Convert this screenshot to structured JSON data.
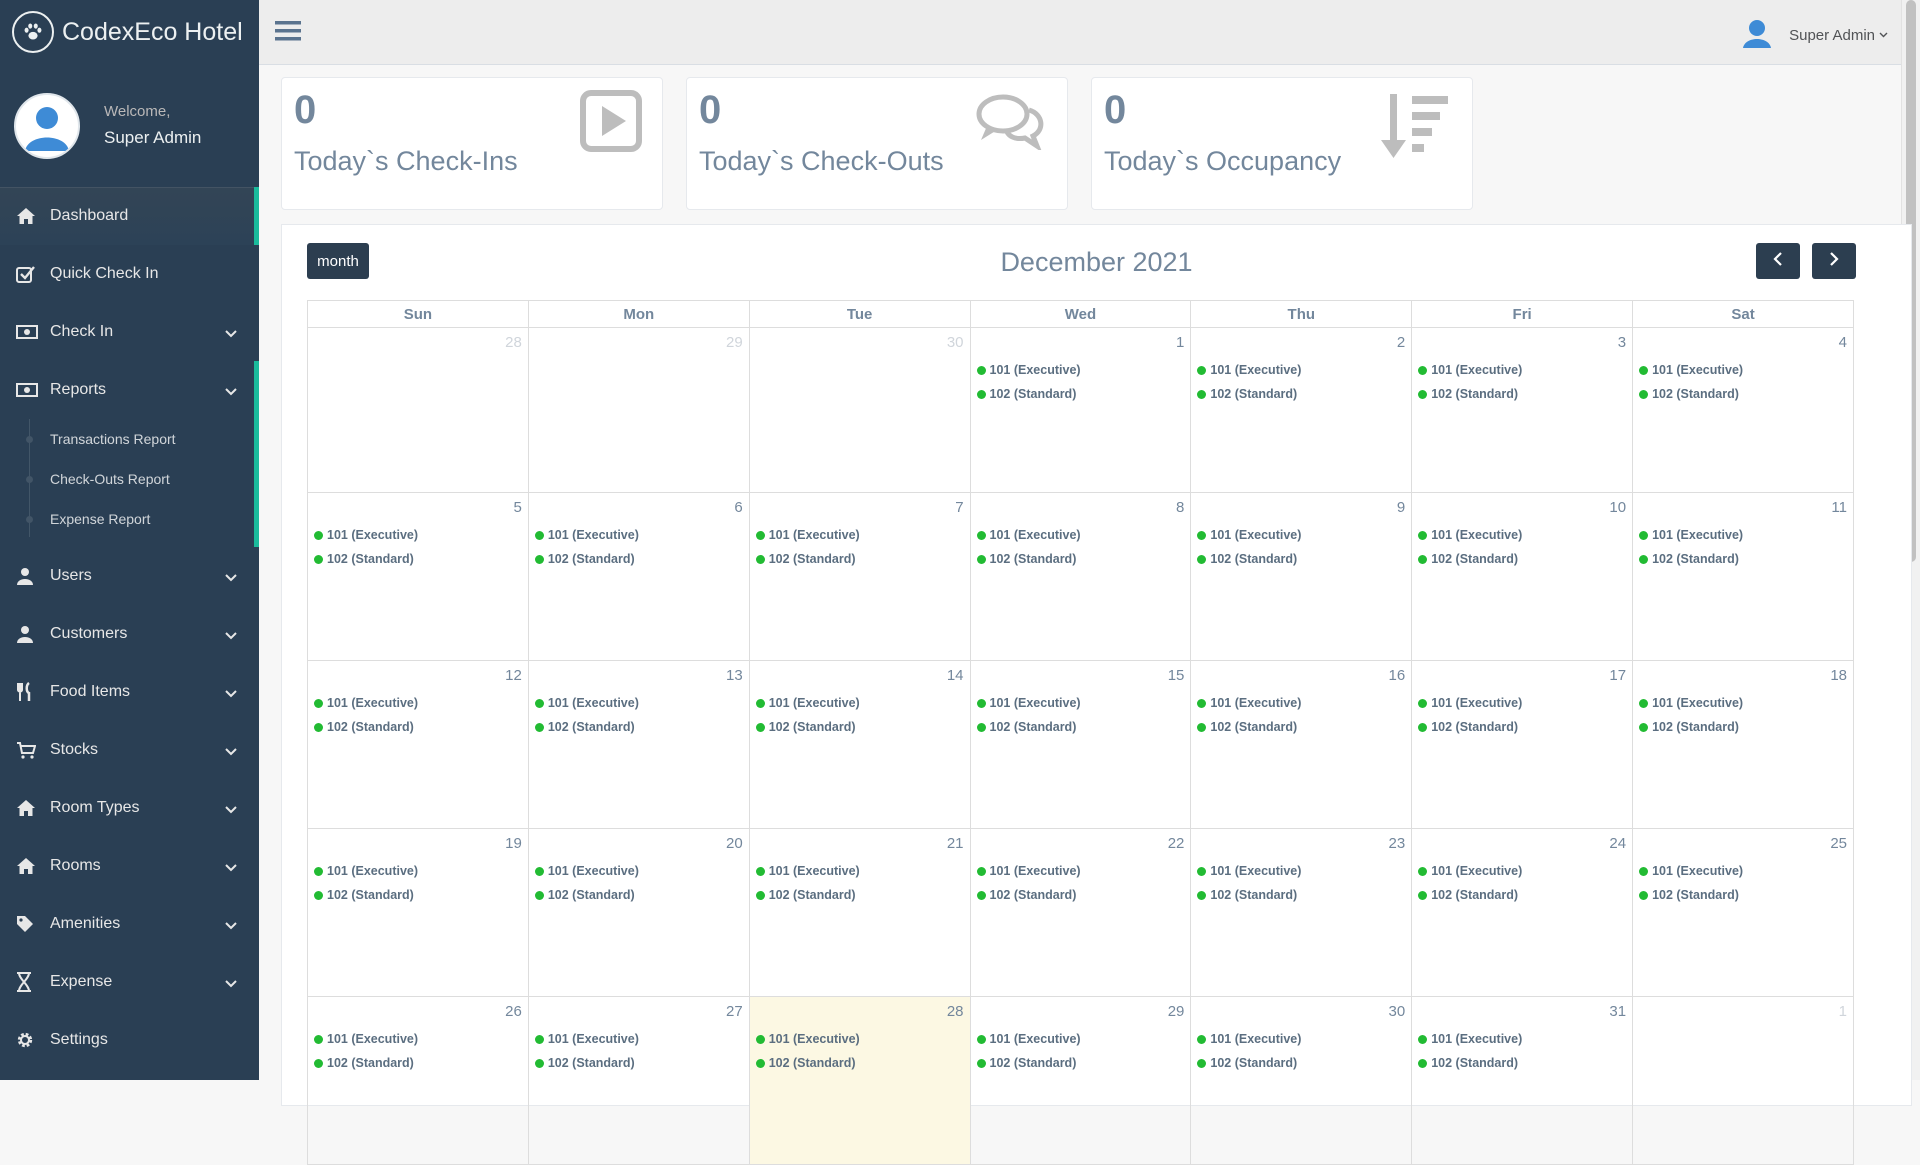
{
  "brand": {
    "name": "CodexEco Hotel"
  },
  "profile": {
    "welcome": "Welcome,",
    "name": "Super Admin"
  },
  "topbar": {
    "user_label": "Super Admin"
  },
  "sidebar": {
    "items": [
      {
        "label": "Dashboard",
        "icon": "home-icon",
        "active": true,
        "chevron": false
      },
      {
        "label": "Quick Check In",
        "icon": "checkbox-icon",
        "chevron": false
      },
      {
        "label": "Check In",
        "icon": "money-icon",
        "chevron": true
      },
      {
        "label": "Reports",
        "icon": "money-icon",
        "chevron": true,
        "open": true
      },
      {
        "label": "Users",
        "icon": "user-icon",
        "chevron": true
      },
      {
        "label": "Customers",
        "icon": "user-icon",
        "chevron": true
      },
      {
        "label": "Food Items",
        "icon": "cutlery-icon",
        "chevron": true
      },
      {
        "label": "Stocks",
        "icon": "cart-icon",
        "chevron": true
      },
      {
        "label": "Room Types",
        "icon": "home-icon",
        "chevron": true
      },
      {
        "label": "Rooms",
        "icon": "home-icon",
        "chevron": true
      },
      {
        "label": "Amenities",
        "icon": "tag-icon",
        "chevron": true
      },
      {
        "label": "Expense",
        "icon": "hourglass-icon",
        "chevron": true
      },
      {
        "label": "Settings",
        "icon": "gear-icon",
        "chevron": false
      }
    ],
    "reports_sub": [
      "Transactions Report",
      "Check-Outs Report",
      "Expense Report"
    ]
  },
  "stats": [
    {
      "count": "0",
      "label": "Today`s Check-Ins",
      "icon": "play-square-icon"
    },
    {
      "count": "0",
      "label": "Today`s Check-Outs",
      "icon": "comments-icon"
    },
    {
      "count": "0",
      "label": "Today`s Occupancy",
      "icon": "sort-amount-desc-icon"
    }
  ],
  "calendar": {
    "view_button": "month",
    "title": "December 2021",
    "weekdays": [
      "Sun",
      "Mon",
      "Tue",
      "Wed",
      "Thu",
      "Fri",
      "Sat"
    ],
    "event_labels": [
      "101 (Executive)",
      "102 (Standard)"
    ],
    "event_color": "#22bb33",
    "today": 28,
    "weeks": [
      [
        {
          "d": "28",
          "o": true
        },
        {
          "d": "29",
          "o": true
        },
        {
          "d": "30",
          "o": true
        },
        {
          "d": "1",
          "e": true
        },
        {
          "d": "2",
          "e": true
        },
        {
          "d": "3",
          "e": true
        },
        {
          "d": "4",
          "e": true
        }
      ],
      [
        {
          "d": "5",
          "e": true
        },
        {
          "d": "6",
          "e": true
        },
        {
          "d": "7",
          "e": true
        },
        {
          "d": "8",
          "e": true
        },
        {
          "d": "9",
          "e": true
        },
        {
          "d": "10",
          "e": true
        },
        {
          "d": "11",
          "e": true
        }
      ],
      [
        {
          "d": "12",
          "e": true
        },
        {
          "d": "13",
          "e": true
        },
        {
          "d": "14",
          "e": true
        },
        {
          "d": "15",
          "e": true
        },
        {
          "d": "16",
          "e": true
        },
        {
          "d": "17",
          "e": true
        },
        {
          "d": "18",
          "e": true
        }
      ],
      [
        {
          "d": "19",
          "e": true
        },
        {
          "d": "20",
          "e": true
        },
        {
          "d": "21",
          "e": true
        },
        {
          "d": "22",
          "e": true
        },
        {
          "d": "23",
          "e": true
        },
        {
          "d": "24",
          "e": true
        },
        {
          "d": "25",
          "e": true
        }
      ],
      [
        {
          "d": "26",
          "e": true
        },
        {
          "d": "27",
          "e": true
        },
        {
          "d": "28",
          "e": true,
          "t": true
        },
        {
          "d": "29",
          "e": true
        },
        {
          "d": "30",
          "e": true
        },
        {
          "d": "31",
          "e": true
        },
        {
          "d": "1",
          "o": true
        }
      ]
    ]
  }
}
